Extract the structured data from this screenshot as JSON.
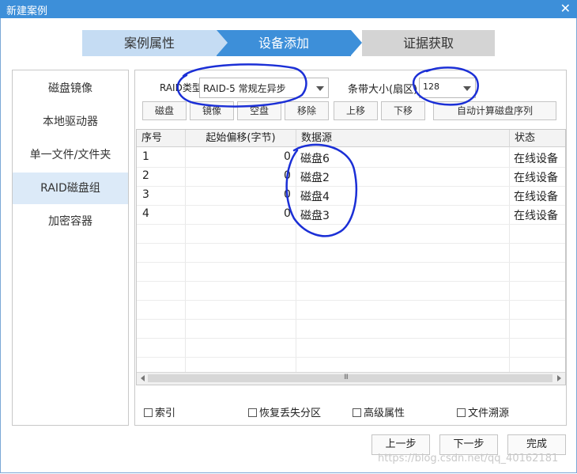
{
  "window": {
    "title": "新建案例",
    "close_icon": "✕"
  },
  "wizard": {
    "steps": [
      "案例属性",
      "设备添加",
      "证据获取"
    ],
    "active": 1
  },
  "left_nav": {
    "items": [
      "磁盘镜像",
      "本地驱动器",
      "单一文件/文件夹",
      "RAID磁盘组",
      "加密容器"
    ],
    "active": 3
  },
  "raid": {
    "type_label": "RAID类型",
    "type_value": "RAID-5 常规左异步",
    "stripe_label": "条带大小(扇区)",
    "stripe_value": "128"
  },
  "toolbar": {
    "buttons": [
      "磁盘",
      "镜像",
      "空盘",
      "移除",
      "上移",
      "下移",
      "自动计算磁盘序列"
    ]
  },
  "table": {
    "columns": [
      "序号",
      "起始偏移(字节)",
      "数据源",
      "状态"
    ],
    "rows": [
      {
        "no": "1",
        "offset": "0",
        "source": "磁盘6",
        "status": "在线设备"
      },
      {
        "no": "2",
        "offset": "0",
        "source": "磁盘2",
        "status": "在线设备"
      },
      {
        "no": "3",
        "offset": "0",
        "source": "磁盘4",
        "status": "在线设备"
      },
      {
        "no": "4",
        "offset": "0",
        "source": "磁盘3",
        "status": "在线设备"
      }
    ],
    "scroll_grip": "III"
  },
  "options": [
    "索引",
    "恢复丢失分区",
    "高级属性",
    "文件溯源"
  ],
  "footer": {
    "prev": "上一步",
    "next": "下一步",
    "finish": "完成",
    "watermark": "https://blog.csdn.net/qq_40162181"
  },
  "colors": {
    "accent": "#3d8fd9",
    "annotation": "#1b2fd6"
  }
}
